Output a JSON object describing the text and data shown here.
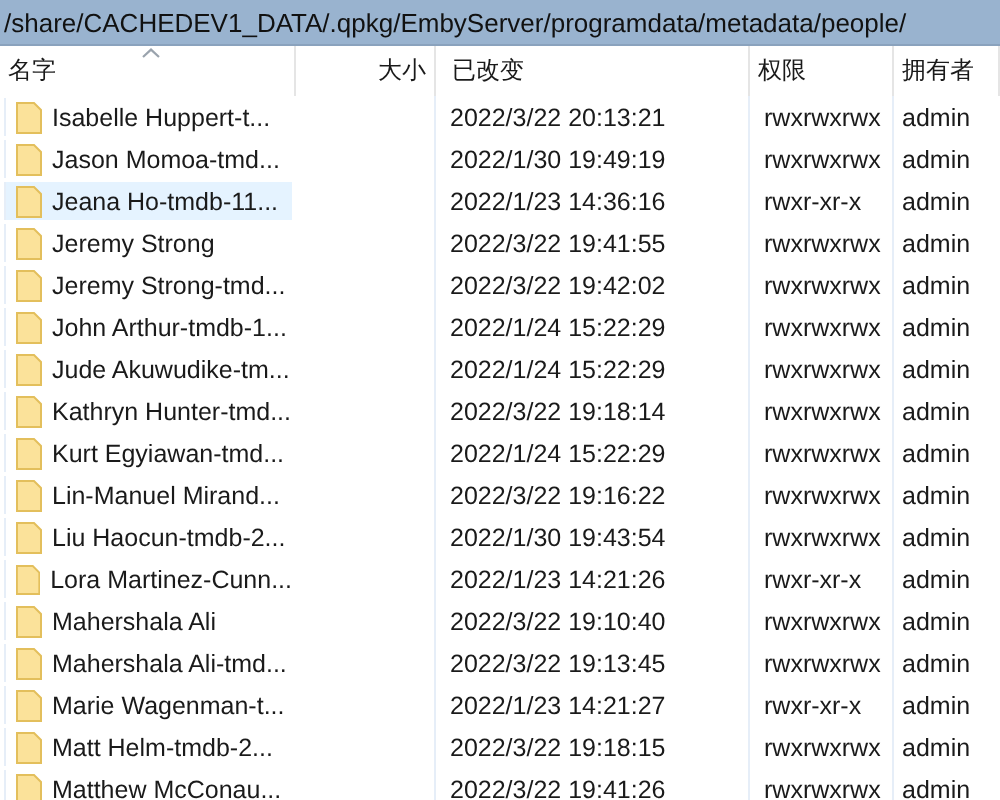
{
  "path_bar": {
    "path": "/share/CACHEDEV1_DATA/.qpkg/EmbyServer/programdata/metadata/people/"
  },
  "table": {
    "columns": [
      {
        "label": "名字",
        "sorted": true
      },
      {
        "label": "大小",
        "sorted": false
      },
      {
        "label": "已改变",
        "sorted": false
      },
      {
        "label": "权限",
        "sorted": false
      },
      {
        "label": "拥有者",
        "sorted": false
      }
    ],
    "rows": [
      {
        "name": "Isabelle Huppert-t...",
        "modified": "2022/3/22 20:13:21",
        "permissions": "rwxrwxrwx",
        "owner": "admin",
        "selected": false
      },
      {
        "name": "Jason Momoa-tmd...",
        "modified": "2022/1/30 19:49:19",
        "permissions": "rwxrwxrwx",
        "owner": "admin",
        "selected": false
      },
      {
        "name": "Jeana Ho-tmdb-11...",
        "modified": "2022/1/23 14:36:16",
        "permissions": "rwxr-xr-x",
        "owner": "admin",
        "selected": true
      },
      {
        "name": "Jeremy Strong",
        "modified": "2022/3/22 19:41:55",
        "permissions": "rwxrwxrwx",
        "owner": "admin",
        "selected": false
      },
      {
        "name": "Jeremy Strong-tmd...",
        "modified": "2022/3/22 19:42:02",
        "permissions": "rwxrwxrwx",
        "owner": "admin",
        "selected": false
      },
      {
        "name": "John Arthur-tmdb-1...",
        "modified": "2022/1/24 15:22:29",
        "permissions": "rwxrwxrwx",
        "owner": "admin",
        "selected": false
      },
      {
        "name": "Jude Akuwudike-tm...",
        "modified": "2022/1/24 15:22:29",
        "permissions": "rwxrwxrwx",
        "owner": "admin",
        "selected": false
      },
      {
        "name": "Kathryn Hunter-tmd...",
        "modified": "2022/3/22 19:18:14",
        "permissions": "rwxrwxrwx",
        "owner": "admin",
        "selected": false
      },
      {
        "name": "Kurt Egyiawan-tmd...",
        "modified": "2022/1/24 15:22:29",
        "permissions": "rwxrwxrwx",
        "owner": "admin",
        "selected": false
      },
      {
        "name": "Lin-Manuel Mirand...",
        "modified": "2022/3/22 19:16:22",
        "permissions": "rwxrwxrwx",
        "owner": "admin",
        "selected": false
      },
      {
        "name": "Liu Haocun-tmdb-2...",
        "modified": "2022/1/30 19:43:54",
        "permissions": "rwxrwxrwx",
        "owner": "admin",
        "selected": false
      },
      {
        "name": "Lora Martinez-Cunn...",
        "modified": "2022/1/23 14:21:26",
        "permissions": "rwxr-xr-x",
        "owner": "admin",
        "selected": false
      },
      {
        "name": "Mahershala Ali",
        "modified": "2022/3/22 19:10:40",
        "permissions": "rwxrwxrwx",
        "owner": "admin",
        "selected": false
      },
      {
        "name": "Mahershala Ali-tmd...",
        "modified": "2022/3/22 19:13:45",
        "permissions": "rwxrwxrwx",
        "owner": "admin",
        "selected": false
      },
      {
        "name": "Marie Wagenman-t...",
        "modified": "2022/1/23 14:21:27",
        "permissions": "rwxr-xr-x",
        "owner": "admin",
        "selected": false
      },
      {
        "name": "Matt Helm-tmdb-2...",
        "modified": "2022/3/22 19:18:15",
        "permissions": "rwxrwxrwx",
        "owner": "admin",
        "selected": false
      },
      {
        "name": "Matthew McConau...",
        "modified": "2022/3/22 19:41:26",
        "permissions": "rwxrwxrwx",
        "owner": "admin",
        "selected": false
      }
    ]
  }
}
